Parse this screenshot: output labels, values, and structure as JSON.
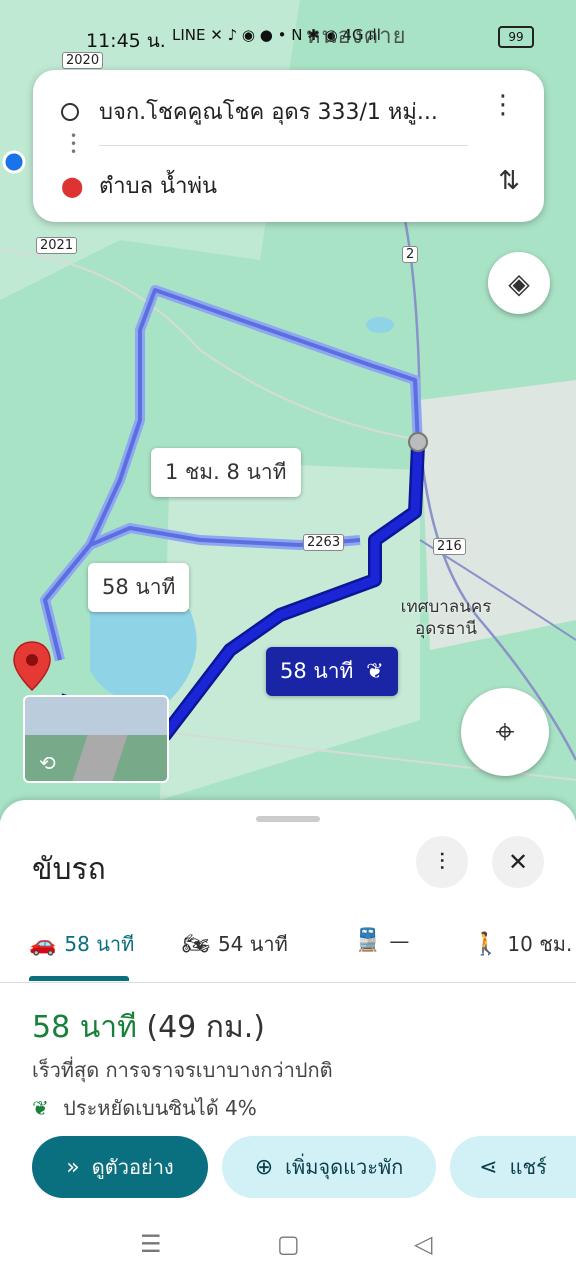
{
  "status_bar": {
    "time": "11:45 น.",
    "place_overlay": "หนองคาย",
    "icons": "LINE ✕ ♪ ◉ ● • N ✱ ◉ 4G ıll",
    "battery": "99"
  },
  "search": {
    "origin": "บจก.โชคคูณโชค อุดร 333/1 หมู่...",
    "destination": "ตำบล น้ำพ่น"
  },
  "map": {
    "road_signs": [
      "2020",
      "2021",
      "2",
      "2263",
      "216"
    ],
    "route_labels": {
      "alt1": "1 ชม. 8 นาที",
      "alt2": "58 นาที",
      "main": "58 นาที"
    },
    "place_label_line1": "เทศบาลนคร",
    "place_label_line2": "อุดรธานี"
  },
  "sheet": {
    "title": "ขับรถ",
    "modes": [
      {
        "icon": "car-icon",
        "label": "58 นาที"
      },
      {
        "icon": "motorcycle-icon",
        "label": "54 นาที"
      },
      {
        "icon": "transit-icon",
        "label": "—"
      },
      {
        "icon": "walk-icon",
        "label": "10 ชม."
      }
    ],
    "summary_time": "58 นาที",
    "summary_distance": "(49 กม.)",
    "subtext": "เร็วที่สุด การจราจรเบาบางกว่าปกติ",
    "eco": "ประหยัดเบนซินได้ 4%",
    "actions": {
      "preview": "ดูตัวอย่าง",
      "add_stop": "เพิ่มจุดแวะพัก",
      "share": "แชร์"
    }
  },
  "colors": {
    "route_main": "#1a25d6",
    "route_alt": "#8fa6f0",
    "accent": "#0a6f7f",
    "map_green": "#a9e3c6"
  }
}
